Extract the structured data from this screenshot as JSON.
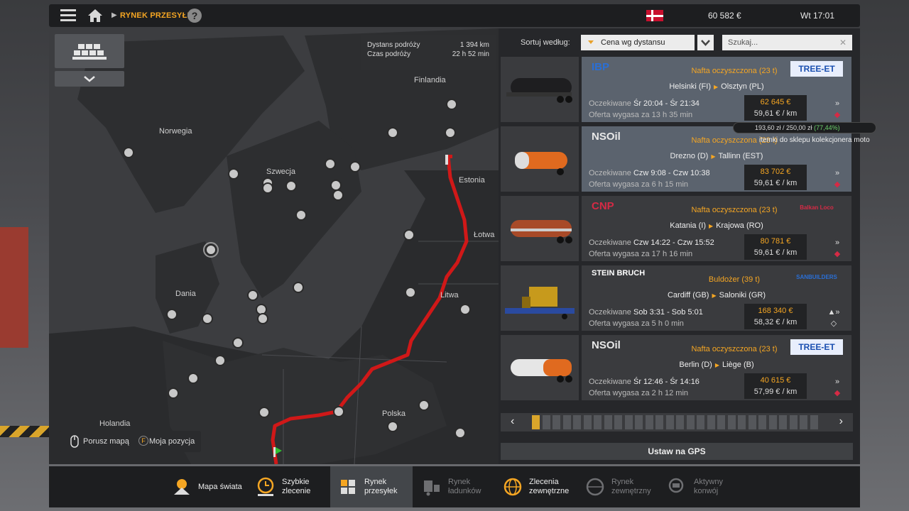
{
  "top": {
    "breadcrumb": "RYNEK PRZESYŁEK",
    "help": "?",
    "money": "60 582 €",
    "clock": "Wt 17:01"
  },
  "route_info": {
    "distance_label": "Dystans podróży",
    "distance": "1 394 km",
    "time_label": "Czas podróży",
    "time": "22 h 52 min"
  },
  "map": {
    "labels": [
      "Finlandia",
      "Norwegia",
      "Szwecja",
      "Estonia",
      "Łotwa",
      "Dania",
      "Litwa",
      "Polska",
      "Holandia"
    ],
    "controls": {
      "move": "Porusz mapą",
      "position_key": "F",
      "position": "Moja pozycja"
    }
  },
  "sort": {
    "label": "Sortuj według:",
    "value": "Cena wg dystansu",
    "search_placeholder": "Szukaj..."
  },
  "jobs": [
    {
      "company": "IBP",
      "cargo": "Nafta oczyszczona (23 t)",
      "client": "TREE-ET",
      "from": "Helsinki (FI)",
      "to": "Olsztyn (PL)",
      "expected_label": "Oczekiwane",
      "expected": "Śr 20:04 - Śr 21:34",
      "expires_label": "Oferta wygasa za",
      "expires": "13 h 35 min",
      "price": "62 645 €",
      "rate": "59,61 € / km"
    },
    {
      "company": "NSOil",
      "cargo": "Nafta oczyszczona (23 t)",
      "client": "",
      "from": "Drezno (D)",
      "to": "Tallinn (EST)",
      "expected_label": "Oczekiwane",
      "expected": "Czw 9:08 - Czw 10:38",
      "expires_label": "Oferta wygasa za",
      "expires": "6 h 15 min",
      "price": "83 702 €",
      "rate": "59,61 € / km"
    },
    {
      "company": "CNP",
      "cargo": "Nafta oczyszczona (23 t)",
      "client": "Balkan Loco",
      "from": "Katania (I)",
      "to": "Krajowa (RO)",
      "expected_label": "Oczekiwane",
      "expected": "Czw 14:22 - Czw 15:52",
      "expires_label": "Oferta wygasa za",
      "expires": "17 h 16 min",
      "price": "80 781 €",
      "rate": "59,61 € / km"
    },
    {
      "company": "STEIN BRUCH",
      "cargo": "Buldożer (39 t)",
      "client": "SANBUILDERS",
      "from": "Cardiff (GB)",
      "to": "Saloniki (GR)",
      "expected_label": "Oczekiwane",
      "expected": "Sob 3:31 - Sob 5:01",
      "expires_label": "Oferta wygasa za",
      "expires": "5 h 0 min",
      "price": "168 340 €",
      "rate": "58,32 € / km"
    },
    {
      "company": "NSOil",
      "cargo": "Nafta oczyszczona (23 t)",
      "client": "TREE-ET",
      "from": "Berlin (D)",
      "to": "Liège (B)",
      "expected_label": "Oczekiwane",
      "expected": "Śr 12:46 - Śr 14:16",
      "expires_label": "Oferta wygasa za",
      "expires": "2 h 12 min",
      "price": "40 615 €",
      "rate": "57,99 € / km"
    }
  ],
  "tooltip": {
    "value": "193,60 zł / 250,00 zł",
    "pct": "(77,44%)",
    "text": "itemki do sklepu kolekcjonera moto"
  },
  "pager": {
    "prev": "‹",
    "next": "›",
    "pages": 28,
    "current": 1
  },
  "gps_button": "Ustaw na GPS",
  "tabs": [
    {
      "label1": "Mapa świata",
      "label2": ""
    },
    {
      "label1": "Szybkie",
      "label2": "zlecenie"
    },
    {
      "label1": "Rynek",
      "label2": "przesyłek"
    },
    {
      "label1": "Rynek",
      "label2": "ładunków"
    },
    {
      "label1": "Zlecenia",
      "label2": "zewnętrzne"
    },
    {
      "label1": "Rynek",
      "label2": "zewnętrzny"
    },
    {
      "label1": "Aktywny",
      "label2": "konwój"
    }
  ],
  "colors": {
    "accent": "#f5a623",
    "route": "#d01818",
    "selected": "#5b636e"
  }
}
